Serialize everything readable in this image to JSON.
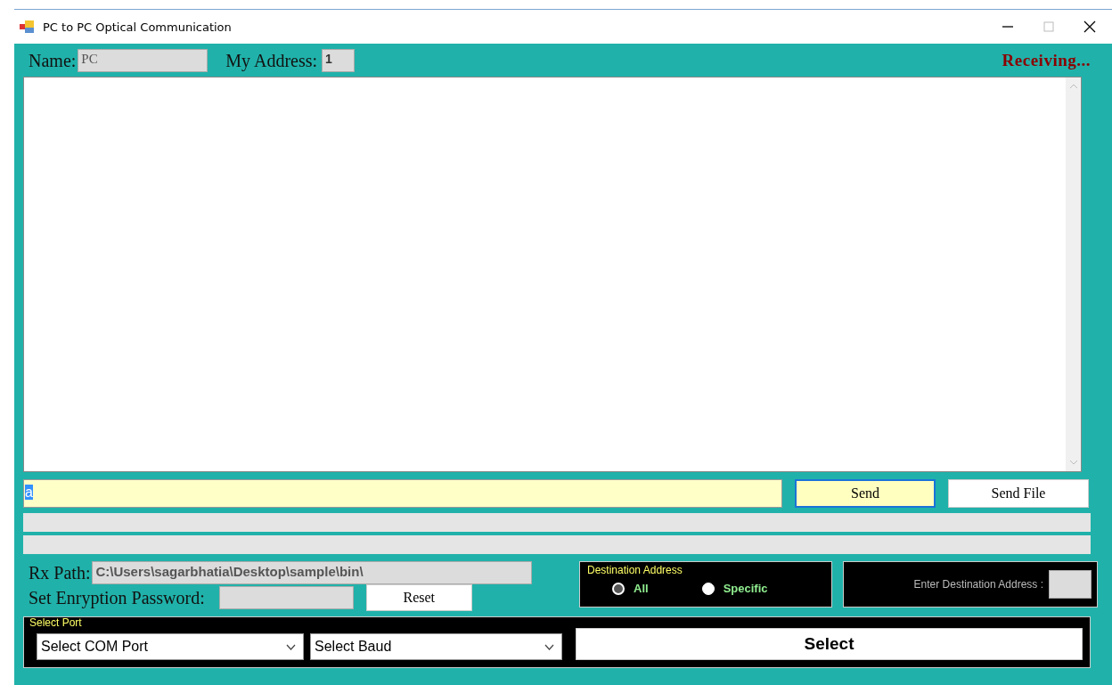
{
  "window": {
    "title": "PC to PC Optical Communication"
  },
  "header": {
    "name_label": "Name:",
    "name_value": "PC",
    "address_label": "My Address:",
    "address_value": "1",
    "status": "Receiving..."
  },
  "message_input": {
    "value": "a"
  },
  "buttons": [
    {
      "label": "Send",
      "focused": true
    },
    {
      "label": "Send File",
      "focused": false
    }
  ],
  "progress_bars": [
    {
      "level": 0
    },
    {
      "level": 0
    }
  ],
  "rx_path": {
    "label": "Rx Path:",
    "value": "C:\\Users\\sagarbhatia\\Desktop\\sample\\bin\\"
  },
  "password": {
    "label": "Set Enryption Password:",
    "reset": "Reset"
  },
  "destination": {
    "title": "Destination Address",
    "options": [
      {
        "label": "All",
        "selected": true
      },
      {
        "label": "Specific",
        "selected": false
      }
    ],
    "address_label": "Enter Destination Address :"
  },
  "port": {
    "title": "Select Port",
    "com": "Select COM Port",
    "baud": "Select Baud",
    "button": "Select"
  }
}
